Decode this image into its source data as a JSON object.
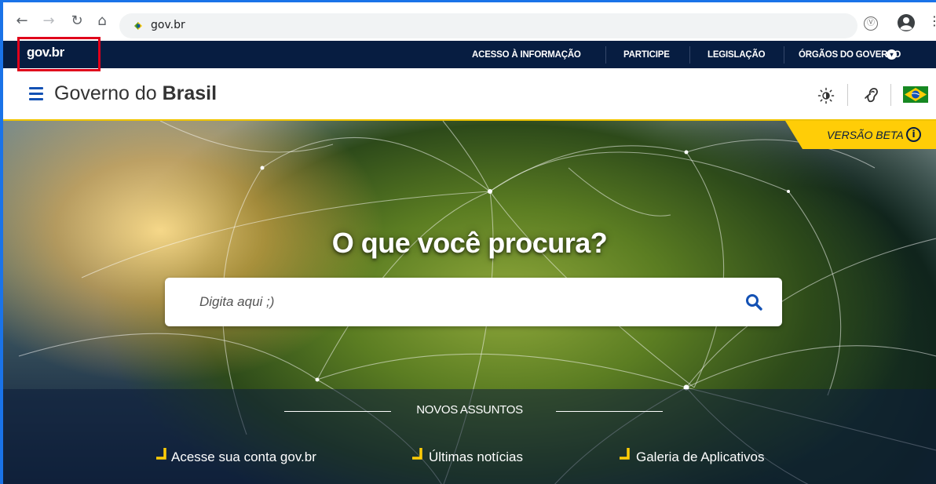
{
  "browser": {
    "url": "gov.br",
    "back_icon": "arrow-left-icon",
    "forward_icon": "arrow-right-icon",
    "reload_icon": "reload-icon",
    "home_icon": "home-icon",
    "extension_icon_glyph": "Ⓥ",
    "menu_glyph": "⋮"
  },
  "top_bar": {
    "logo": "gov.br",
    "links": [
      "ACESSO À INFORMAÇÃO",
      "PARTICIPE",
      "LEGISLAÇÃO",
      "ÓRGÃOS DO GOVERNO"
    ],
    "background": "#071d41"
  },
  "header": {
    "title_regular": "Governo do ",
    "title_bold": "Brasil",
    "accent": "#1351b4"
  },
  "hero": {
    "beta_label": "VERSÃO BETA",
    "beta_info_glyph": "i",
    "title": "O que você procura?",
    "search_placeholder": "Digita aqui ;)"
  },
  "novos": {
    "title": "NOVOS ASSUNTOS",
    "links": [
      "Acesse sua conta gov.br",
      "Últimas notícias",
      "Galeria de Aplicativos"
    ],
    "accent": "#ffcd07"
  }
}
